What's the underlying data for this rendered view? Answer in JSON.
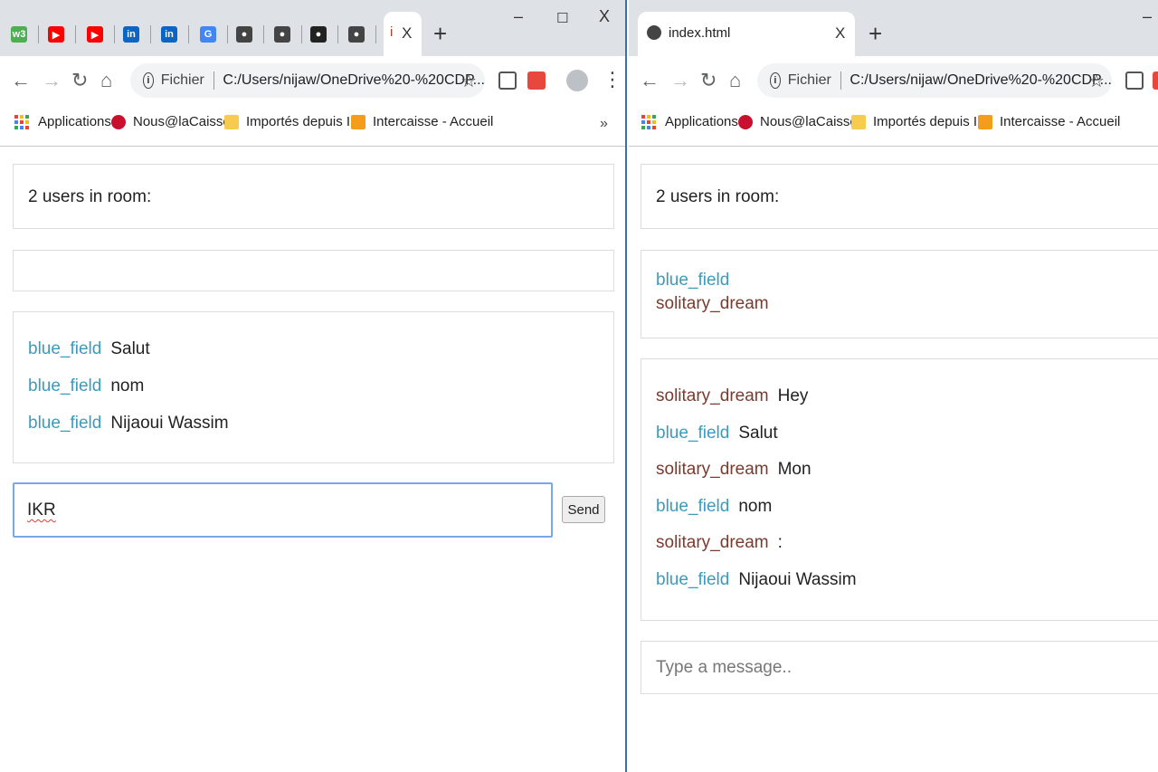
{
  "left_window": {
    "tabs": [
      {
        "icon": "w3schools-icon",
        "fav_text": "w3",
        "color": "#4caf50"
      },
      {
        "icon": "youtube-icon",
        "fav_text": "▶",
        "color": "#ff0000"
      },
      {
        "icon": "youtube-icon",
        "fav_text": "▶",
        "color": "#ff0000"
      },
      {
        "icon": "linkedin-icon",
        "fav_text": "in",
        "color": "#0a66c2"
      },
      {
        "icon": "linkedin-icon",
        "fav_text": "in",
        "color": "#0a66c2"
      },
      {
        "icon": "google-icon",
        "fav_text": "G",
        "color": "#4285f4"
      },
      {
        "icon": "globe-icon",
        "fav_text": "●",
        "color": "#444444"
      },
      {
        "icon": "globe-icon",
        "fav_text": "●",
        "color": "#444444"
      },
      {
        "icon": "github-icon",
        "fav_text": "●",
        "color": "#222222"
      },
      {
        "icon": "globe-icon",
        "fav_text": "●",
        "color": "#444444"
      }
    ],
    "active_tab_label": "i",
    "tab_close": "X",
    "new_tab": "+",
    "window_controls": {
      "minimize": "–",
      "maximize": "☐",
      "close": "X"
    },
    "omnibox": {
      "scheme": "Fichier",
      "url": "C:/Users/nijaw/OneDrive%20-%20CDP..."
    },
    "bookmarks": [
      {
        "label": "Applications",
        "icon": "apps-grid-icon"
      },
      {
        "label": "Nous@laCaisse",
        "icon": "nous-icon"
      },
      {
        "label": "Importés depuis IE",
        "icon": "folder-icon"
      },
      {
        "label": "Intercaisse - Accueil",
        "icon": "intercaisse-icon"
      }
    ],
    "more_bookmarks": "»",
    "users_count": "2 users in room:",
    "messages": [
      {
        "user": "blue_field",
        "text": "Salut",
        "color": "blue"
      },
      {
        "user": "blue_field",
        "text": "nom",
        "color": "blue"
      },
      {
        "user": "blue_field",
        "text": "Nijaoui Wassim",
        "color": "blue"
      }
    ],
    "message_input_value": "IKR",
    "send_label": "Send"
  },
  "right_window": {
    "tab_title": "index.html",
    "tab_close": "X",
    "new_tab": "+",
    "window_minimize": "–",
    "omnibox": {
      "scheme": "Fichier",
      "url": "C:/Users/nijaw/OneDrive%20-%20CDP..."
    },
    "bookmarks": [
      {
        "label": "Applications",
        "icon": "apps-grid-icon"
      },
      {
        "label": "Nous@laCaisse",
        "icon": "nous-icon"
      },
      {
        "label": "Importés depuis IE",
        "icon": "folder-icon"
      },
      {
        "label": "Intercaisse - Accueil",
        "icon": "intercaisse-icon"
      }
    ],
    "users_count": "2 users in room:",
    "users": [
      {
        "name": "blue_field",
        "color": "blue"
      },
      {
        "name": "solitary_dream",
        "color": "red"
      }
    ],
    "messages": [
      {
        "user": "solitary_dream",
        "text": "Hey",
        "color": "red"
      },
      {
        "user": "blue_field",
        "text": "Salut",
        "color": "blue"
      },
      {
        "user": "solitary_dream",
        "text": "Mon",
        "color": "red"
      },
      {
        "user": "blue_field",
        "text": "nom",
        "color": "blue"
      },
      {
        "user": "solitary_dream",
        "text": ":",
        "color": "red"
      },
      {
        "user": "blue_field",
        "text": "Nijaoui Wassim",
        "color": "blue"
      }
    ],
    "message_input_placeholder": "Type a message.."
  },
  "colors": {
    "user_blue": "#3c9bbd",
    "user_red": "#7a3b2e",
    "focus_border": "#7aa7ea"
  }
}
